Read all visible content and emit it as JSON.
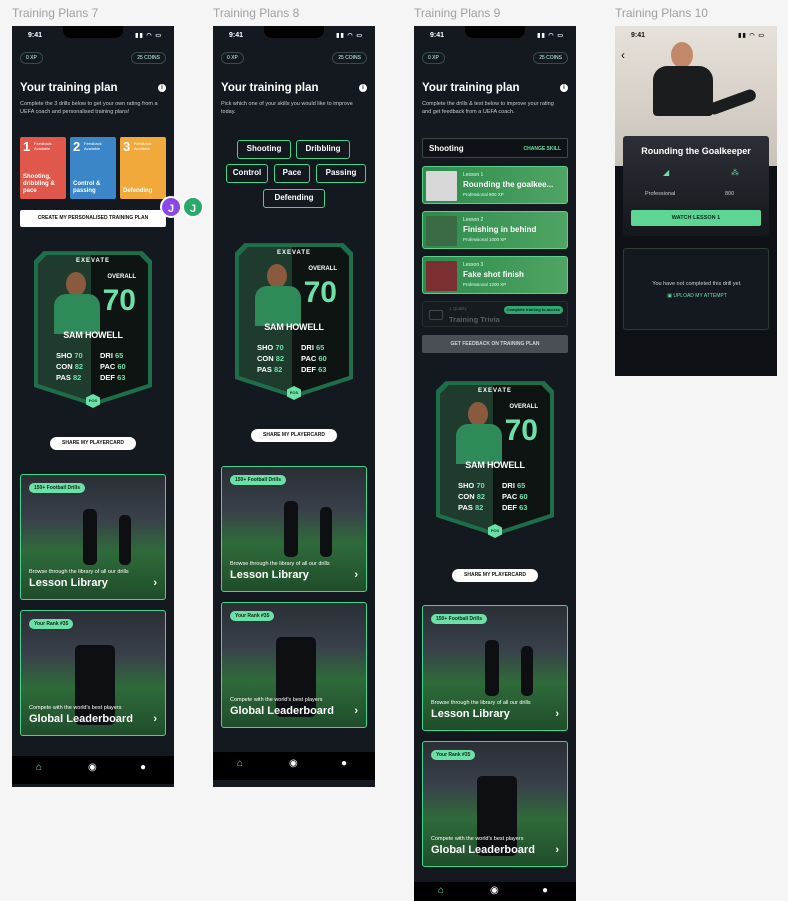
{
  "frames": [
    {
      "label": "Training Plans 7"
    },
    {
      "label": "Training Plans 8"
    },
    {
      "label": "Training Plans 9"
    },
    {
      "label": "Training Plans 10"
    }
  ],
  "status": {
    "time": "9:41"
  },
  "header": {
    "xp": "0 XP",
    "coins": "25 COINS"
  },
  "tp7": {
    "title": "Your training plan",
    "intro": "Complete the 3 drills below to get your own rating from a UEFA coach and personalised training plans!",
    "drills": [
      {
        "num": "1",
        "feedback": "Feedback Available",
        "name": "Shooting, dribbling & pace",
        "color": "#e0584b"
      },
      {
        "num": "2",
        "feedback": "Feedback Available",
        "name": "Control & passing",
        "color": "#3a86c8"
      },
      {
        "num": "3",
        "feedback": "Feedback Available",
        "name": "Defending",
        "color": "#f2a93b"
      }
    ],
    "cta": "CREATE MY PERSONALISED TRAINING PLAN",
    "avatars": [
      "J",
      "J"
    ]
  },
  "tp8": {
    "title": "Your training plan",
    "intro": "Pick which one of your skills you would like to improve today.",
    "skills": [
      "Shooting",
      "Dribbling",
      "Control",
      "Pace",
      "Passing",
      "Defending"
    ]
  },
  "tp9": {
    "title": "Your training plan",
    "intro": "Complete the drills & test below to improve your rating and get feedback from a UEFA coach.",
    "skill": "Shooting",
    "change": "CHANGE SKILL",
    "lessons": [
      {
        "num": "Lesson 1",
        "title": "Rounding the goalkee...",
        "meta": "Professional   800 XP"
      },
      {
        "num": "Lesson 2",
        "title": "Finishing in behind",
        "meta": "Professional   1000 XP"
      },
      {
        "num": "Lesson 3",
        "title": "Fake shot finish",
        "meta": "Professional   1200 XP"
      }
    ],
    "trivia_small": "1 Quality",
    "trivia": "Training Trivia",
    "trivia_badge": "Complete training to access",
    "feedback_btn": "GET FEEDBACK ON TRAINING PLAN"
  },
  "tp10": {
    "title": "Rounding the Goalkeeper",
    "level": "Professional",
    "xp": "800",
    "watch": "WATCH LESSON 1",
    "not_completed": "You have not completed this drill yet.",
    "upload": "UPLOAD MY ATTEMPT"
  },
  "playercard": {
    "brand": "EXEVATE",
    "overall_label": "OVERALL",
    "overall": "70",
    "name": "SAM HOWELL",
    "stats_left": [
      {
        "k": "SHO",
        "v": "70"
      },
      {
        "k": "CON",
        "v": "82"
      },
      {
        "k": "PAS",
        "v": "82"
      }
    ],
    "stats_right": [
      {
        "k": "DRI",
        "v": "65"
      },
      {
        "k": "PAC",
        "v": "60"
      },
      {
        "k": "DEF",
        "v": "63"
      }
    ],
    "position": "POS",
    "share": "SHARE MY PLAYERCARD"
  },
  "lesson_library": {
    "badge": "150+ Football Drills",
    "sub": "Browse through the library of all our drills",
    "title": "Lesson Library"
  },
  "leaderboard": {
    "badge": "Your Rank #35",
    "sub": "Compete with the world's best players",
    "title": "Global Leaderboard"
  },
  "colors": {
    "accent": "#6de0a8",
    "bg": "#141920",
    "border": "#3dd68c"
  },
  "icons": {
    "home": "home-icon",
    "community": "community-icon",
    "profile": "profile-icon",
    "chevron": "chevron-right-icon"
  }
}
